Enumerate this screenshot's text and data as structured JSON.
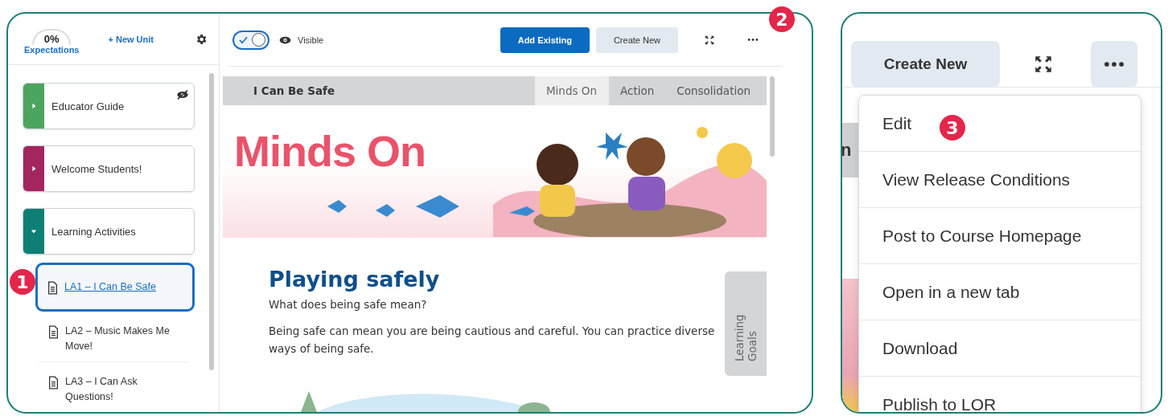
{
  "sidebar": {
    "progress": "0%",
    "progress_label": "Expectations",
    "new_unit": "+ New Unit",
    "units": [
      {
        "title": "Educator Guide",
        "color": "#4ca55e",
        "expanded": false,
        "hidden": true
      },
      {
        "title": "Welcome Students!",
        "color": "#a3265f",
        "expanded": false,
        "hidden": false
      },
      {
        "title": "Learning Activities",
        "color": "#0e7f74",
        "expanded": true,
        "hidden": false,
        "children": [
          {
            "title": "LA1 – I Can Be Safe",
            "selected": true
          },
          {
            "title": "LA2 – Music Makes Me Move!",
            "selected": false
          },
          {
            "title": "LA3 – I Can Ask Questions!",
            "selected": false
          }
        ]
      }
    ]
  },
  "callout_sidebar": "1",
  "callout_toolbar": "2",
  "callout_menu": "3",
  "toolbar": {
    "visible_toggle": {
      "on": true,
      "label": "Visible"
    },
    "buttons": [
      {
        "label": "Add Existing",
        "kind": "primary"
      },
      {
        "label": "Create New",
        "kind": "secondary"
      }
    ]
  },
  "lesson": {
    "title": "I Can Be Safe",
    "tabs": [
      {
        "label": "Minds On",
        "selected": true
      },
      {
        "label": "Action",
        "selected": false
      },
      {
        "label": "Consolidation",
        "selected": false
      }
    ],
    "banner_title": "Minds On",
    "heading": "Playing safely",
    "question": "What does being safe mean?",
    "paragraph": "Being safe can mean you are being cautious and careful. You can practice diverse ways of being safe.",
    "side_tab": "Learning Goals"
  },
  "zoom_panel": {
    "tab_fragment": "n",
    "create_button": "Create New",
    "menu": {
      "open": true,
      "items": [
        "Edit",
        "View Release Conditions",
        "Post to Course Homepage",
        "Open in a new tab",
        "Download",
        "Publish to LOR"
      ]
    }
  }
}
